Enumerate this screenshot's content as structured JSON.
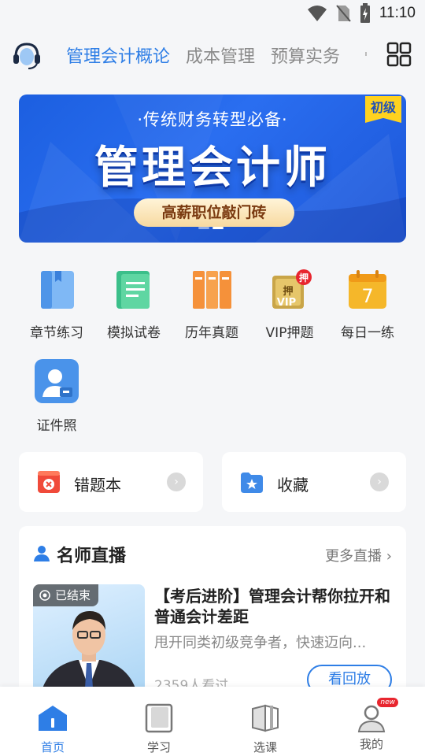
{
  "status_bar": {
    "time": "11:10"
  },
  "top_nav": {
    "tabs": [
      {
        "label": "管理会计概论",
        "active": true
      },
      {
        "label": "成本管理",
        "active": false
      },
      {
        "label": "预算实务",
        "active": false
      }
    ]
  },
  "banner": {
    "subtitle": "·传统财务转型必备·",
    "title": "管理会计师",
    "pill": "高薪职位敲门砖",
    "tag": "初级"
  },
  "quick_actions": [
    {
      "label": "章节练习",
      "icon": "book-icon"
    },
    {
      "label": "模拟试卷",
      "icon": "paper-icon"
    },
    {
      "label": "历年真题",
      "icon": "books-icon"
    },
    {
      "label": "VIP押题",
      "icon": "vip-scroll-icon",
      "badge": "押"
    },
    {
      "label": "每日一练",
      "icon": "calendar-icon",
      "number": "7"
    },
    {
      "label": "证件照",
      "icon": "id-photo-icon"
    }
  ],
  "shortcuts": {
    "wrong_book": "错题本",
    "favorites": "收藏"
  },
  "live": {
    "section_title": "名师直播",
    "more": "更多直播",
    "status_badge": "已结束",
    "course_title": "【考后进阶】管理会计帮你拉开和普通会计差距",
    "description": "甩开同类初级竞争者，快速迈向...",
    "viewers": "2359人看过",
    "replay": "看回放"
  },
  "bottom_nav": [
    {
      "label": "首页",
      "active": true
    },
    {
      "label": "学习",
      "active": false
    },
    {
      "label": "选课",
      "active": false
    },
    {
      "label": "我的",
      "active": false,
      "badge": "new"
    }
  ],
  "colors": {
    "accent": "#2e7ee6",
    "banner_blue": "#2a6ef0",
    "background": "#f5f6f8"
  }
}
